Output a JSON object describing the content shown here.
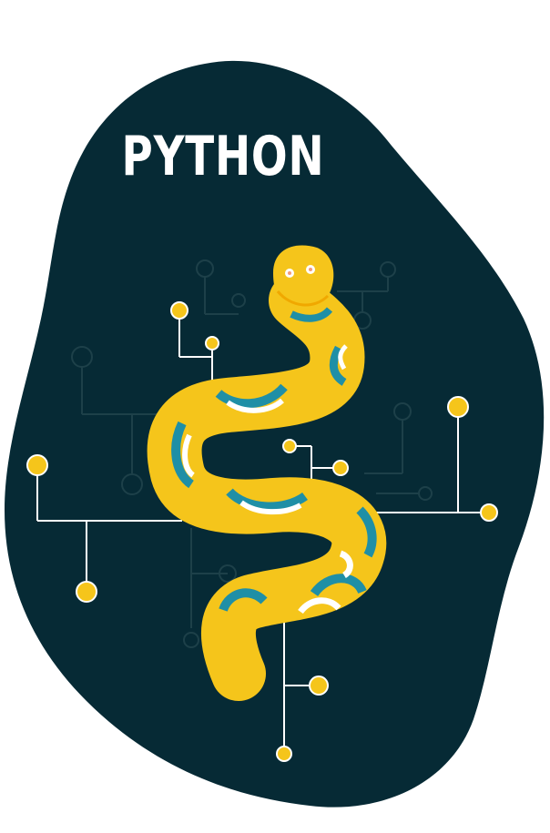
{
  "title": "PYTHON",
  "colors": {
    "background": "#ffffff",
    "blob": "#062a35",
    "circuit_dark": "#1b3e48",
    "circuit_light": "#ffffff",
    "node": "#f5c51b",
    "snake_body": "#f5c51b",
    "snake_band": "#1f8fa6",
    "snake_stripe": "#ffffff"
  },
  "icons": {
    "snake": "python-snake-icon",
    "circuit": "circuit-board-icon"
  }
}
